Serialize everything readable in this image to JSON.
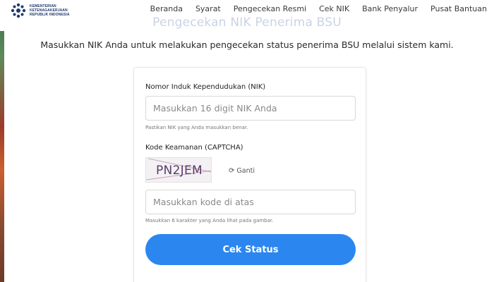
{
  "header": {
    "logo_text": [
      "KEMENTERIAN",
      "KETENAGAKERJAAN",
      "REPUBLIK INDONESIA"
    ],
    "nav": [
      "Beranda",
      "Syarat",
      "Pengecekan Resmi",
      "Cek NIK",
      "Bank Penyalur",
      "Pusat Bantuan"
    ]
  },
  "page": {
    "title": "Pengecekan NIK Penerima BSU",
    "subtitle": "Masukkan NIK Anda untuk melakukan pengecekan status penerima BSU melalui sistem kami."
  },
  "form": {
    "nik_label": "Nomor Induk Kependudukan (NIK)",
    "nik_placeholder": "Masukkan 16 digit NIK Anda",
    "nik_hint": "Pastikan NIK yang Anda masukkan benar.",
    "captcha_label": "Kode Keamanan (CAPTCHA)",
    "captcha_code": "PN2JEM",
    "refresh_label": "Ganti",
    "captcha_placeholder": "Masukkan kode di atas",
    "captcha_hint": "Masukkan 6 karakter yang Anda lihat pada gambar.",
    "submit_label": "Cek Status"
  },
  "icons": {
    "logo": "ministry-logo-icon",
    "refresh": "refresh-icon"
  },
  "colors": {
    "primary_button": "#2b86f0",
    "title_faded": "#c9d3e6"
  }
}
